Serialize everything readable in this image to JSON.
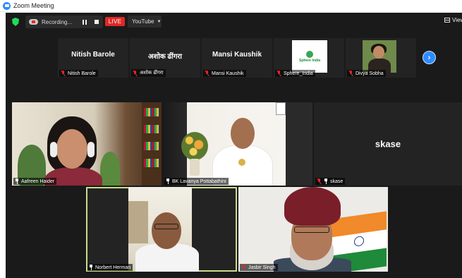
{
  "window": {
    "title": "Zoom Meeting"
  },
  "topbar": {
    "recording_label": "Recording...",
    "live_label": "LIVE",
    "stream_target": "YouTube",
    "view_label": "View"
  },
  "strip": [
    {
      "big_name": "Nitish Barole",
      "label": "Nitish Barole",
      "muted": true
    },
    {
      "big_name": "अशोक ढींगरा",
      "label": "अशोक ढींगरा",
      "muted": true
    },
    {
      "big_name": "Mansi Kaushik",
      "label": "Mansi Kaushik",
      "muted": true
    },
    {
      "big_name": "",
      "label": "Sphere_India",
      "muted": true,
      "logo_text": "Sphere India"
    },
    {
      "big_name": "",
      "label": "Divya Sobha",
      "muted": true
    }
  ],
  "gallery": {
    "aafreen": {
      "label": "Aafreen Haider"
    },
    "lavanya": {
      "label": "BK Lavanya Pottabathini"
    },
    "skase": {
      "label": "skase",
      "center_name": "skase"
    },
    "norbert": {
      "label": "Norbert Herman"
    },
    "jasbir": {
      "label": "Jasbir Singh"
    }
  },
  "colors": {
    "zoom_blue": "#2d8cff",
    "live_red": "#e02828",
    "security_green": "#23d959",
    "active_speaker_border": "#c9dd8a"
  }
}
